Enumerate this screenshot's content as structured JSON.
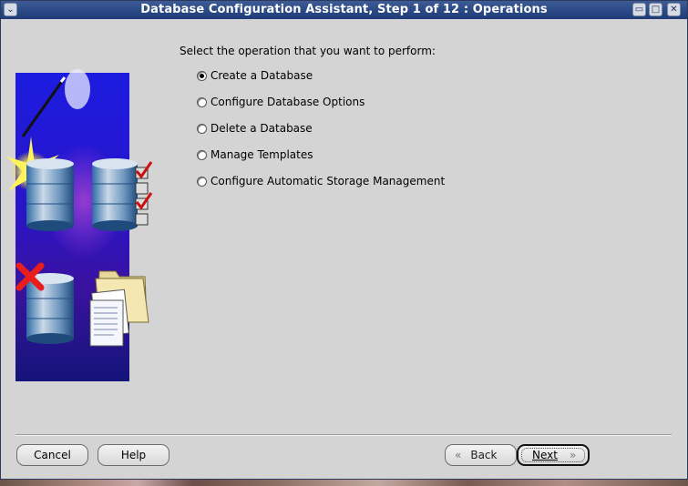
{
  "window": {
    "title": "Database Configuration Assistant, Step 1 of 12 : Operations",
    "controls": {
      "menu": "⌄",
      "minimize": "▭",
      "maximize": "□",
      "close": "✕"
    }
  },
  "main": {
    "prompt": "Select the operation that you want to perform:",
    "options": [
      {
        "label": "Create a Database",
        "selected": true
      },
      {
        "label": "Configure Database Options",
        "selected": false
      },
      {
        "label": "Delete a Database",
        "selected": false
      },
      {
        "label": "Manage Templates",
        "selected": false
      },
      {
        "label": "Configure Automatic Storage Management",
        "selected": false
      }
    ]
  },
  "buttons": {
    "cancel": "Cancel",
    "help": "Help",
    "back": "Back",
    "next": "Next",
    "back_icon": "«",
    "next_icon": "»"
  },
  "colors": {
    "titlebar": "#2b4a86",
    "window_bg": "#d4d4d4",
    "illustration_bg": "#1a1acc",
    "checkmark": "#cc1111"
  }
}
